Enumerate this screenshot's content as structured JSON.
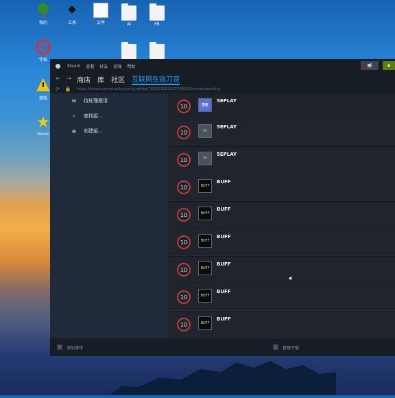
{
  "desktop": {
    "icons": [
      {
        "label": "我的"
      },
      {
        "label": "工具"
      },
      {
        "label": "文件"
      },
      {
        "label": "AI"
      },
      {
        "label": "PR"
      },
      {
        "label": "学校"
      },
      {
        "label": "游戏"
      },
      {
        "label": "music"
      }
    ]
  },
  "steam": {
    "menu": [
      "Steam",
      "查看",
      "好友",
      "游戏",
      "帮助"
    ],
    "nav": [
      "商店",
      "库",
      "社区",
      "互联网在逃刀哥"
    ],
    "url": "https://steamcommunity.com/profiles/76561199192570562/friends/pending",
    "left_items": [
      {
        "label": "待处理邀请",
        "icon": "envelope-icon"
      },
      {
        "label": "查找组...",
        "icon": "search-icon"
      },
      {
        "label": "创建组...",
        "icon": "plus-circle-icon"
      }
    ],
    "rows": [
      {
        "badge": "10",
        "name": "5EPLAY",
        "avatar": "5E"
      },
      {
        "badge": "10",
        "name": "5EPLAY",
        "avatar": "5E"
      },
      {
        "badge": "10",
        "name": "5EPLAY",
        "avatar": "5E"
      },
      {
        "badge": "10",
        "name": "BUFF",
        "avatar": "BUFF"
      },
      {
        "badge": "10",
        "name": "BUFF",
        "avatar": "BUFF"
      },
      {
        "badge": "10",
        "name": "BUFF",
        "avatar": "BUFF"
      },
      {
        "badge": "10",
        "name": "BUFF",
        "avatar": "BUFF"
      },
      {
        "badge": "10",
        "name": "BUFF",
        "avatar": "BUFF"
      },
      {
        "badge": "10",
        "name": "BUFF",
        "avatar": "BUFF"
      }
    ],
    "bottom": {
      "add_game": "添加游戏",
      "manage_downloads": "管理下载"
    }
  }
}
